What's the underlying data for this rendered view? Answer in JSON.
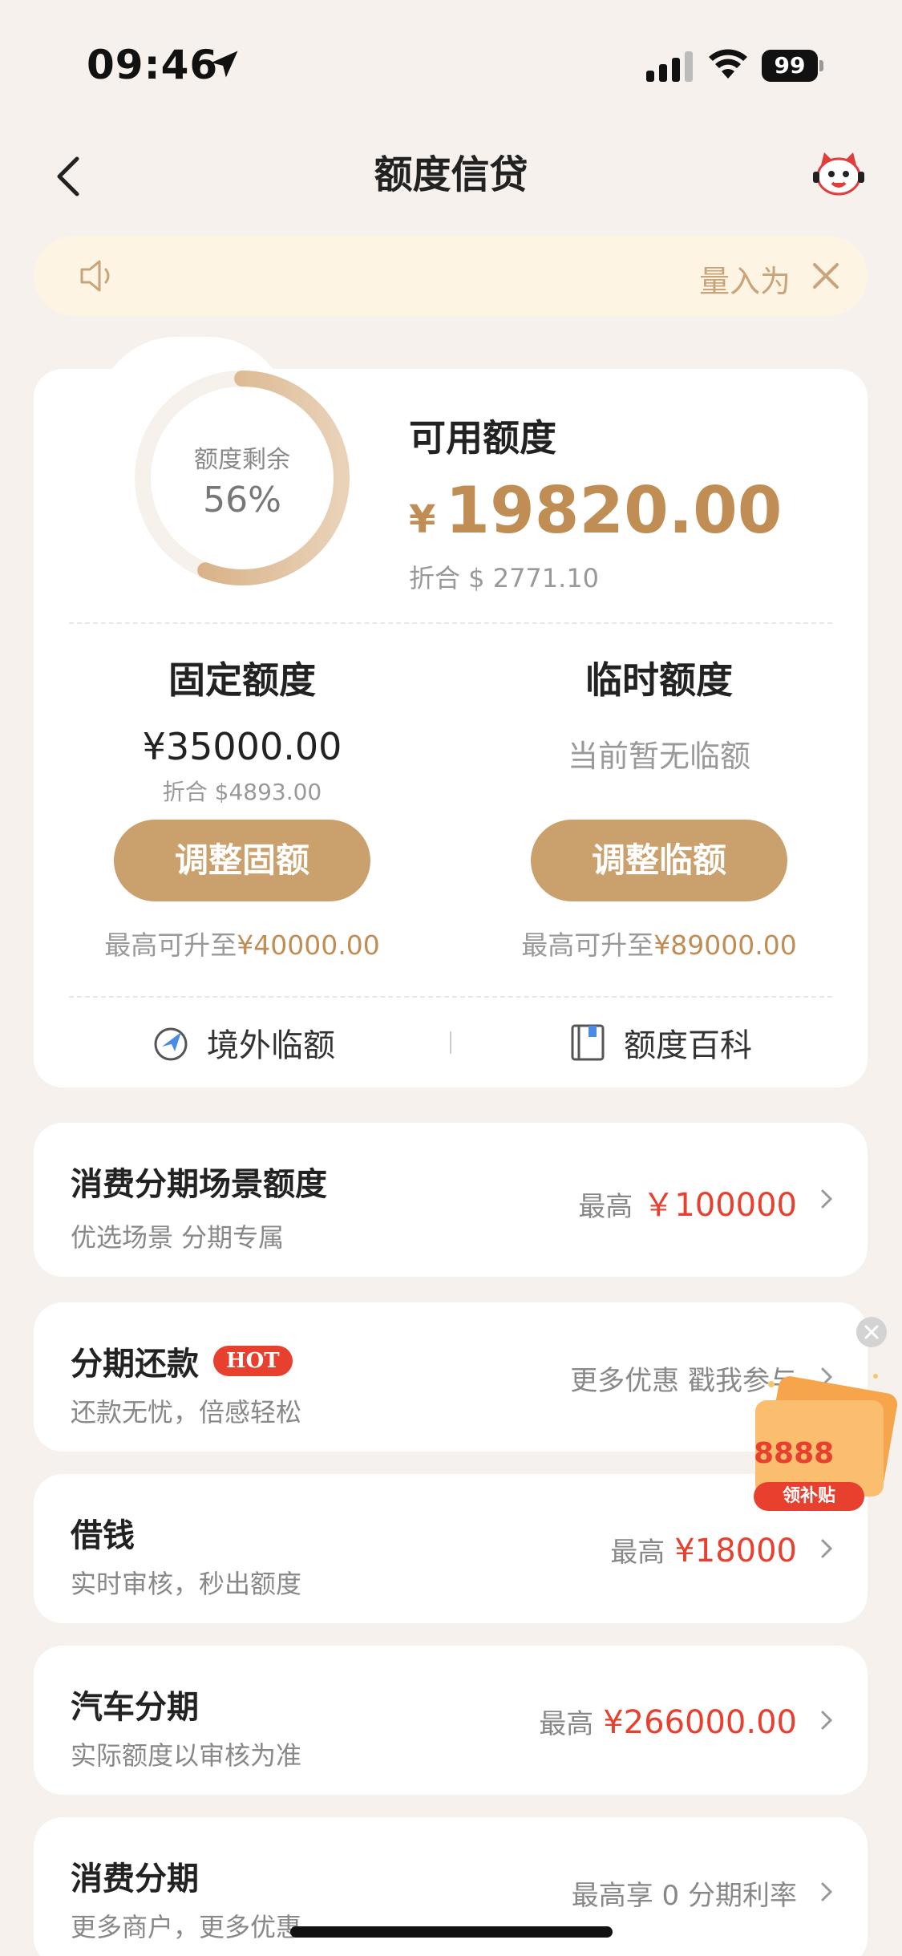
{
  "status_bar": {
    "time": "09:46",
    "battery": "99"
  },
  "nav": {
    "title": "额度信贷"
  },
  "notice": {
    "text": "量入为"
  },
  "credit": {
    "ring_label": "额度剩余",
    "ring_value": "56%",
    "ring_percent": 56,
    "available_title": "可用额度",
    "currency": "¥",
    "available_amount": "19820.00",
    "available_usd": "折合 $ 2771.10"
  },
  "fixed": {
    "title": "固定额度",
    "value": "¥35000.00",
    "usd": "折合 $4893.00",
    "button": "调整固额",
    "max_prefix": "最高可升至",
    "max_amount": "¥40000.00"
  },
  "temporary": {
    "title": "临时额度",
    "empty": "当前暂无临额",
    "button": "调整临额",
    "max_prefix": "最高可升至",
    "max_amount": "¥89000.00"
  },
  "links": {
    "overseas": "境外临额",
    "encyclopedia": "额度百科"
  },
  "items": [
    {
      "title": "消费分期场景额度",
      "sub": "优选场景 分期专属",
      "prefix": "最高",
      "amount": "￥100000"
    },
    {
      "title": "分期还款",
      "badge": "HOT",
      "sub": "还款无忧，倍感轻松",
      "right": "更多优惠 戳我参与"
    },
    {
      "title": "借钱",
      "sub": "实时审核，秒出额度",
      "prefix": "最高",
      "amount": "¥18000"
    },
    {
      "title": "汽车分期",
      "sub": "实际额度以审核为准",
      "prefix": "最高",
      "amount": "¥266000.00"
    },
    {
      "title": "消费分期",
      "sub": "更多商户，更多优惠",
      "right": "最高享 0 分期利率"
    }
  ],
  "promo": {
    "amount": "8888",
    "badge": "领补贴"
  },
  "colors": {
    "accent": "#c08e55",
    "button": "#caa06c",
    "red": "#e8402f",
    "background": "#f6f1ed"
  }
}
